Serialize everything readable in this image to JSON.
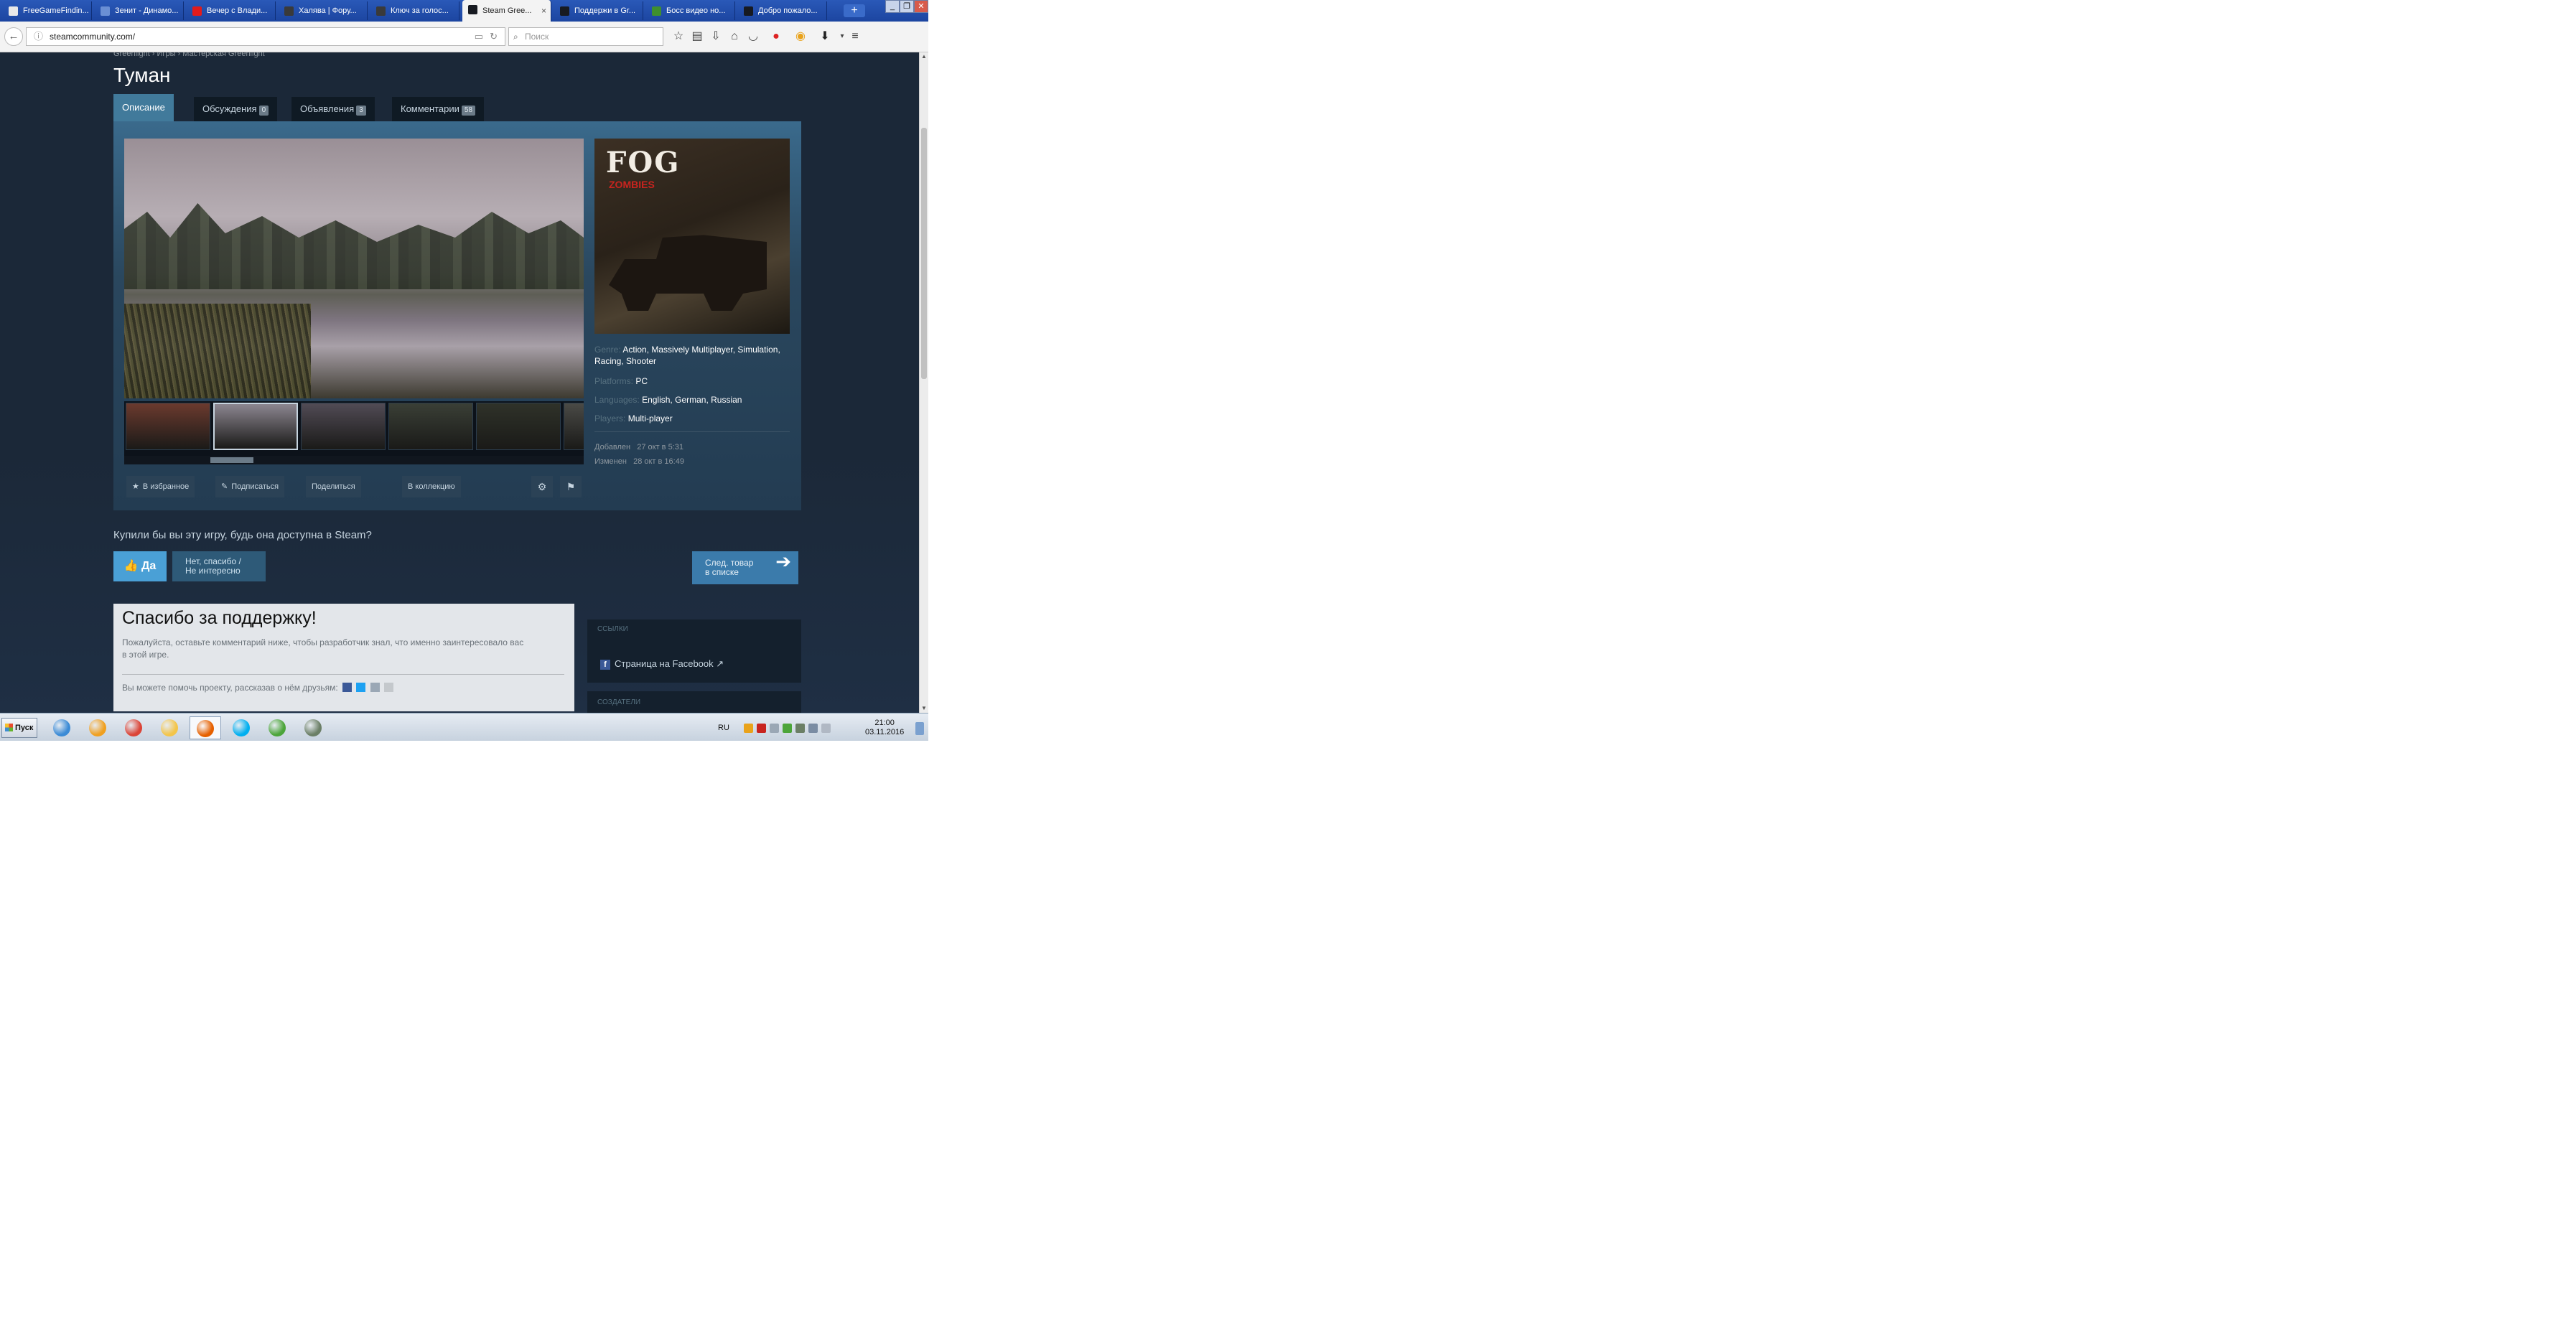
{
  "browser": {
    "tabs": [
      {
        "title": "FreeGameFindin...",
        "fav": "#e8e8e8"
      },
      {
        "title": "Зенит - Динамо...",
        "fav": "#6a8fd4"
      },
      {
        "title": "Вечер с Влади...",
        "fav": "#e21b1b"
      },
      {
        "title": "Халява | Фору...",
        "fav": "#3a3a3a"
      },
      {
        "title": "Ключ за голос...",
        "fav": "#3a3a3a"
      },
      {
        "title": "Steam Gree...",
        "fav": "#171a21"
      },
      {
        "title": "Поддержи в Gr...",
        "fav": "#171a21"
      },
      {
        "title": "Босс видео но...",
        "fav": "#3f8f2f"
      },
      {
        "title": "Добро пожало...",
        "fav": "#171a21"
      }
    ],
    "active_tab_index": 5,
    "close_glyph": "×",
    "new_tab_glyph": "+",
    "url": "steamcommunity.com/",
    "search_placeholder": "Поиск"
  },
  "page": {
    "breadcrumb": "Greenlight › Игры › Мастерская Greenlight",
    "title": "Туман",
    "tabs": [
      {
        "label": "Описание",
        "count": ""
      },
      {
        "label": "Обсуждения",
        "count": "0"
      },
      {
        "label": "Объявления",
        "count": "3"
      },
      {
        "label": "Комментарии",
        "count": "58"
      }
    ],
    "capsule": {
      "logo_text": "FOG",
      "logo_sub": "ZOMBIES"
    },
    "meta": {
      "genre_label": "Genre:",
      "genre_value": "Action, Massively Multiplayer, Simulation, Racing, Shooter",
      "platforms_label": "Platforms:",
      "platforms_value": "PC",
      "languages_label": "Languages:",
      "languages_value": "English, German, Russian",
      "players_label": "Players:",
      "players_value": "Multi-player",
      "added_label": "Добавлен",
      "added_value": "27 окт в 5:31",
      "changed_label": "Изменен",
      "changed_value": "28 окт в 16:49"
    },
    "actions": {
      "favorite": "В избранное",
      "follow": "Подписаться",
      "share": "Поделиться",
      "collection": "В коллекцию"
    },
    "thumb_colors": [
      "#6b3a2e",
      "#8c8690",
      "#514b55",
      "#3a3f36",
      "#2f3229",
      "#4a4a46"
    ],
    "vote": {
      "question": "Купили бы вы эту игру, будь она доступна в Steam?",
      "yes": "Да",
      "no_line1": "Нет, спасибо /",
      "no_line2": "Не интересно",
      "next_line1": "След. товар",
      "next_line2": "в списке"
    },
    "thanks": {
      "title": "Спасибо за поддержку!",
      "text": "Пожалуйста, оставьте комментарий ниже, чтобы разработчик знал, что именно заинтересовало вас в этой игре.",
      "share_text": "Вы можете помочь проекту, рассказав о нём друзьям:"
    },
    "links": {
      "heading": "ССЫЛКИ",
      "facebook": "Страница на Facebook"
    },
    "developers": {
      "heading": "СОЗДАТЕЛИ"
    }
  },
  "taskbar": {
    "start": "Пуск",
    "apps": [
      {
        "name": "ie",
        "color": "#3b8bd6"
      },
      {
        "name": "media",
        "color": "#f0a020"
      },
      {
        "name": "chrome",
        "color": "#db4437"
      },
      {
        "name": "explorer",
        "color": "#f3c54a"
      },
      {
        "name": "firefox",
        "color": "#e66000"
      },
      {
        "name": "skype",
        "color": "#00aff0"
      },
      {
        "name": "utorrent",
        "color": "#4ca53a"
      },
      {
        "name": "steam",
        "color": "#6b7f66"
      }
    ],
    "lang": "RU",
    "time": "21:00",
    "date": "03.11.2016"
  }
}
